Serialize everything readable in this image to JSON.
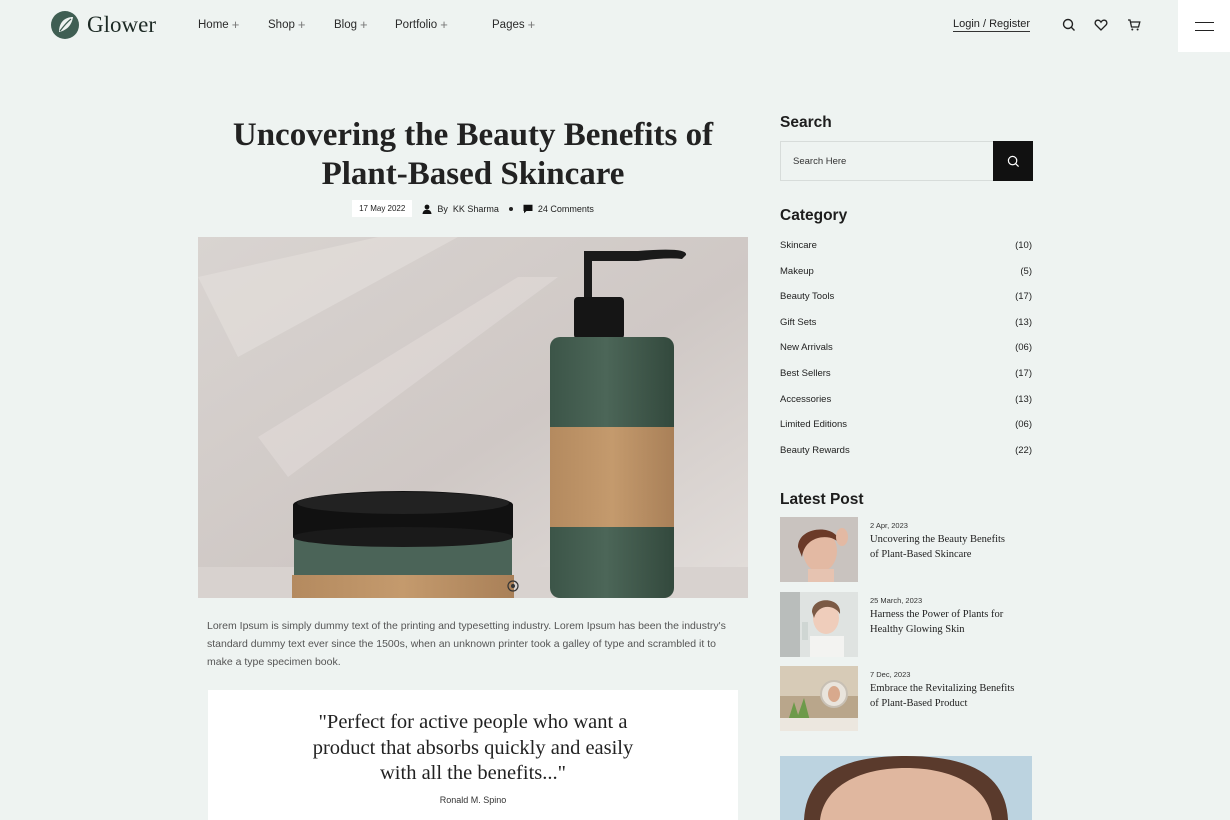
{
  "brand": {
    "name": "Glower"
  },
  "nav": {
    "items": [
      {
        "label": "Home",
        "suffix": "+"
      },
      {
        "label": "Shop",
        "suffix": "+"
      },
      {
        "label": "Blog",
        "suffix": "+"
      },
      {
        "label": "Portfolio",
        "suffix": "+"
      },
      {
        "label": "Pages",
        "suffix": "+"
      }
    ],
    "login_label": "Login / Register"
  },
  "icons": {
    "header": [
      "search-icon",
      "heart-icon",
      "cart-icon",
      "hamburger-menu-icon"
    ],
    "meta": [
      "user-icon",
      "comment-icon"
    ]
  },
  "article": {
    "title": "Uncovering the Beauty Benefits of Plant-Based Skincare",
    "date": "17 May 2022",
    "author_prefix": "By",
    "author": "KK Sharma",
    "comments": "24 Comments",
    "body": "Lorem Ipsum is simply dummy text of the printing and typesetting industry. Lorem Ipsum has been the industry's standard dummy text ever since the 1500s, when an unknown printer took a galley of type and scrambled it to make a type specimen book.",
    "quote": "\"Perfect for active people who want a product that absorbs quickly and easily with all the benefits...\"",
    "quote_author": "Ronald M. Spino"
  },
  "sidebar": {
    "search": {
      "heading": "Search",
      "placeholder": "Search Here"
    },
    "category": {
      "heading": "Category",
      "items": [
        {
          "name": "Skincare",
          "count": "(10)"
        },
        {
          "name": "Makeup",
          "count": "(5)"
        },
        {
          "name": "Beauty Tools",
          "count": "(17)"
        },
        {
          "name": "Gift Sets",
          "count": "(13)"
        },
        {
          "name": "New Arrivals",
          "count": "(06)"
        },
        {
          "name": "Best Sellers",
          "count": "(17)"
        },
        {
          "name": "Accessories",
          "count": "(13)"
        },
        {
          "name": "Limited Editions",
          "count": "(06)"
        },
        {
          "name": "Beauty Rewards",
          "count": "(22)"
        }
      ]
    },
    "latest": {
      "heading": "Latest Post",
      "posts": [
        {
          "date": "2 Apr, 2023",
          "title": "Uncovering the Beauty Benefits of Plant-Based Skincare"
        },
        {
          "date": "25 March, 2023",
          "title": "Harness the Power of Plants for Healthy Glowing Skin"
        },
        {
          "date": "7 Dec, 2023",
          "title": "Embrace the Revitalizing Benefits of Plant-Based Product"
        }
      ]
    }
  },
  "colors": {
    "background": "#eef3f1",
    "brand_green": "#3f5e53",
    "dark": "#111111",
    "white": "#ffffff"
  }
}
